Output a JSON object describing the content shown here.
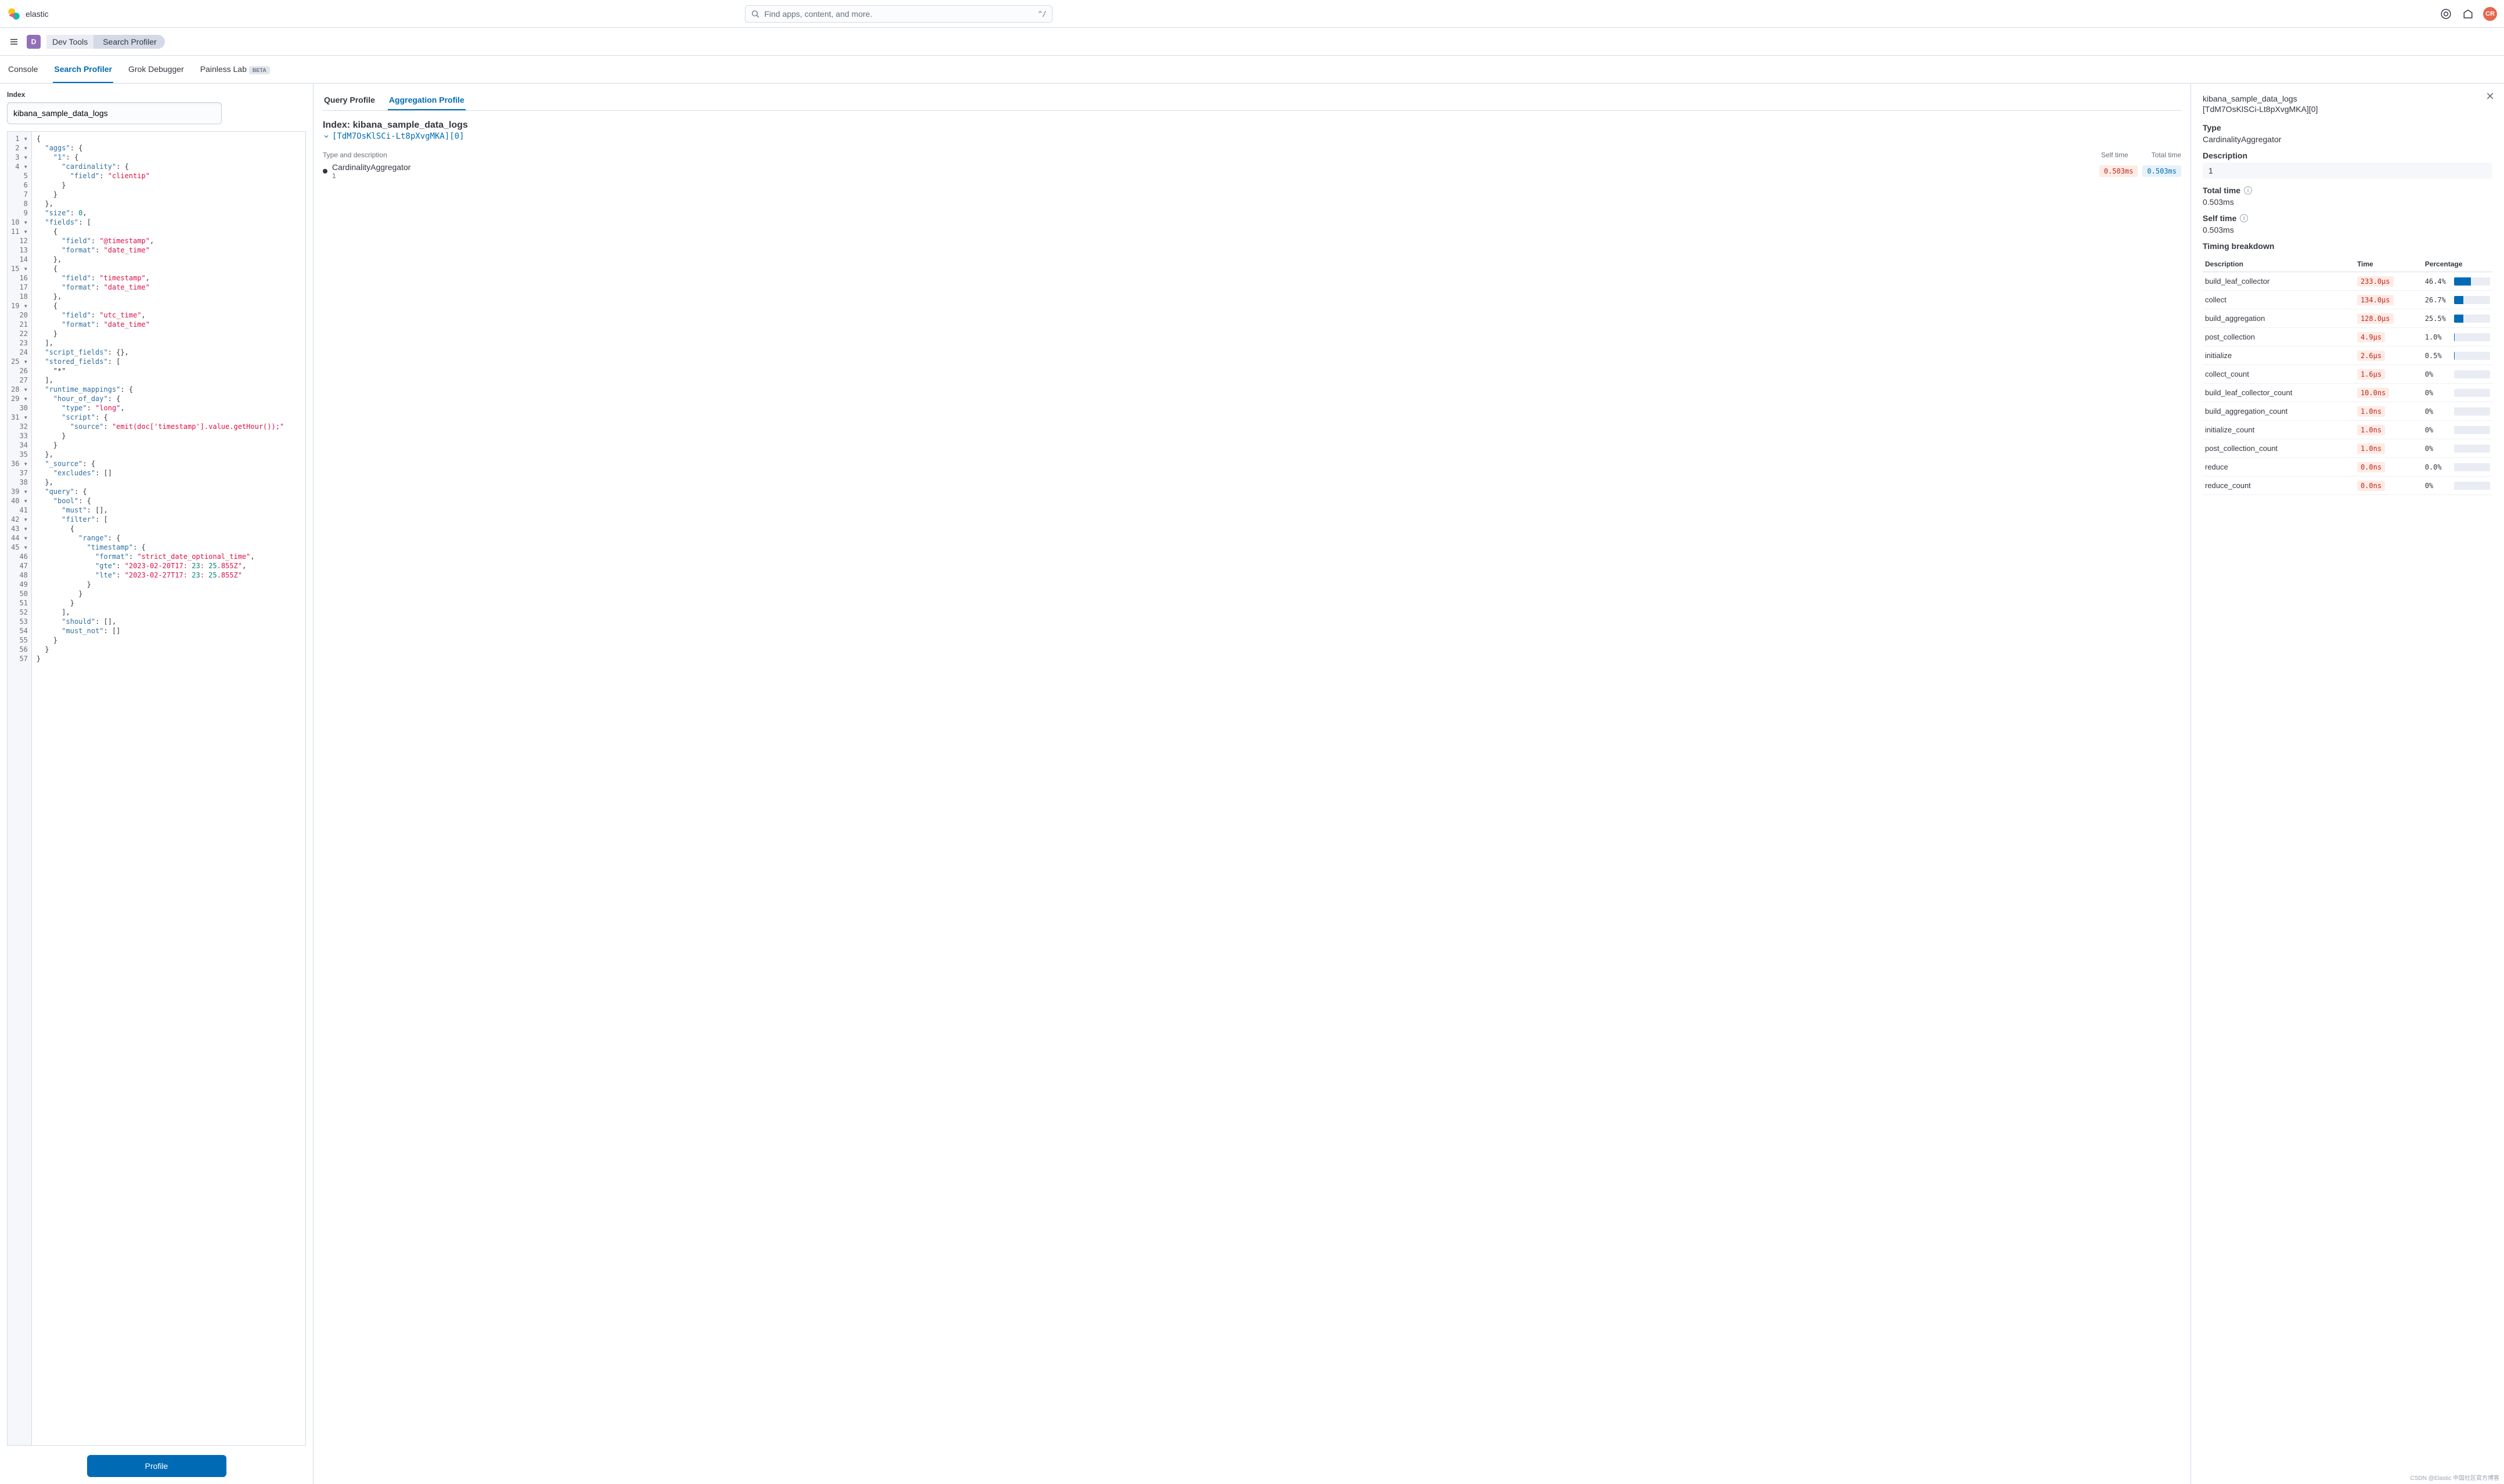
{
  "header": {
    "logo_text": "elastic",
    "search_placeholder": "Find apps, content, and more.",
    "search_shortcut": "^/",
    "avatar_initials": "CR"
  },
  "breadcrumb": {
    "d_badge": "D",
    "items": [
      "Dev Tools",
      "Search Profiler"
    ]
  },
  "tool_tabs": {
    "items": [
      "Console",
      "Search Profiler",
      "Grok Debugger",
      "Painless Lab"
    ],
    "active_index": 1,
    "beta_label": "BETA"
  },
  "left": {
    "index_label": "Index",
    "index_value": "kibana_sample_data_logs",
    "profile_button": "Profile",
    "editor_lines": [
      "{",
      "  \"aggs\": {",
      "    \"1\": {",
      "      \"cardinality\": {",
      "        \"field\": \"clientip\"",
      "      }",
      "    }",
      "  },",
      "  \"size\": 0,",
      "  \"fields\": [",
      "    {",
      "      \"field\": \"@timestamp\",",
      "      \"format\": \"date_time\"",
      "    },",
      "    {",
      "      \"field\": \"timestamp\",",
      "      \"format\": \"date_time\"",
      "    },",
      "    {",
      "      \"field\": \"utc_time\",",
      "      \"format\": \"date_time\"",
      "    }",
      "  ],",
      "  \"script_fields\": {},",
      "  \"stored_fields\": [",
      "    \"*\"",
      "  ],",
      "  \"runtime_mappings\": {",
      "    \"hour_of_day\": {",
      "      \"type\": \"long\",",
      "      \"script\": {",
      "        \"source\": \"emit(doc['timestamp'].value.getHour());\"",
      "      }",
      "    }",
      "  },",
      "  \"_source\": {",
      "    \"excludes\": []",
      "  },",
      "  \"query\": {",
      "    \"bool\": {",
      "      \"must\": [],",
      "      \"filter\": [",
      "        {",
      "          \"range\": {",
      "            \"timestamp\": {",
      "              \"format\": \"strict_date_optional_time\",",
      "              \"gte\": \"2023-02-20T17:23:25.855Z\",",
      "              \"lte\": \"2023-02-27T17:23:25.855Z\"",
      "            }",
      "          }",
      "        }",
      "      ],",
      "      \"should\": [],",
      "      \"must_not\": []",
      "    }",
      "  }",
      "}"
    ],
    "fold_lines": [
      1,
      2,
      3,
      4,
      10,
      11,
      15,
      19,
      25,
      28,
      29,
      31,
      36,
      39,
      40,
      42,
      43,
      44,
      45
    ]
  },
  "center": {
    "tabs": [
      "Query Profile",
      "Aggregation Profile"
    ],
    "active_tab": 1,
    "index_title_prefix": "Index:",
    "index_title_value": "kibana_sample_data_logs",
    "shard_link": "[TdM7OsKlSCi-Lt8pXvgMKA][0]",
    "col_type": "Type and description",
    "col_self": "Self time",
    "col_total": "Total time",
    "agg_name": "CardinalityAggregator",
    "agg_sub": "1",
    "self_time": "0.503ms",
    "total_time": "0.503ms"
  },
  "right": {
    "title": "kibana_sample_data_logs",
    "subtitle": "[TdM7OsKlSCi-Lt8pXvgMKA][0]",
    "type_label": "Type",
    "type_value": "CardinalityAggregator",
    "description_label": "Description",
    "description_value": "1",
    "total_time_label": "Total time",
    "total_time_value": "0.503ms",
    "self_time_label": "Self time",
    "self_time_value": "0.503ms",
    "timing_label": "Timing breakdown",
    "cols": {
      "desc": "Description",
      "time": "Time",
      "pct": "Percentage"
    },
    "rows": [
      {
        "desc": "build_leaf_collector",
        "time": "233.0µs",
        "pct": "46.4%",
        "fill": 46.4
      },
      {
        "desc": "collect",
        "time": "134.0µs",
        "pct": "26.7%",
        "fill": 26.7
      },
      {
        "desc": "build_aggregation",
        "time": "128.0µs",
        "pct": "25.5%",
        "fill": 25.5
      },
      {
        "desc": "post_collection",
        "time": "4.9µs",
        "pct": "1.0%",
        "fill": 1.0
      },
      {
        "desc": "initialize",
        "time": "2.6µs",
        "pct": "0.5%",
        "fill": 0.5
      },
      {
        "desc": "collect_count",
        "time": "1.6µs",
        "pct": "0%",
        "fill": 0
      },
      {
        "desc": "build_leaf_collector_count",
        "time": "10.0ns",
        "pct": "0%",
        "fill": 0
      },
      {
        "desc": "build_aggregation_count",
        "time": "1.0ns",
        "pct": "0%",
        "fill": 0
      },
      {
        "desc": "initialize_count",
        "time": "1.0ns",
        "pct": "0%",
        "fill": 0
      },
      {
        "desc": "post_collection_count",
        "time": "1.0ns",
        "pct": "0%",
        "fill": 0
      },
      {
        "desc": "reduce",
        "time": "0.0ns",
        "pct": "0.0%",
        "fill": 0
      },
      {
        "desc": "reduce_count",
        "time": "0.0ns",
        "pct": "0%",
        "fill": 0
      }
    ]
  },
  "watermark": "CSDN @Elastic 中国社区官方博客"
}
